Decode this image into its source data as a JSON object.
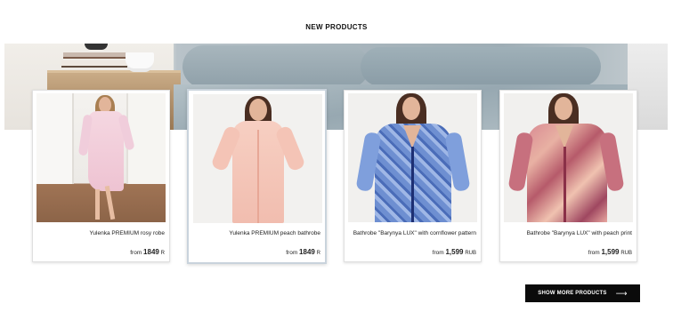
{
  "section": {
    "title": "NEW PRODUCTS"
  },
  "products": [
    {
      "name": "Yulenka PREMIUM rosy robe",
      "price_prefix": "from",
      "price": "1849",
      "currency": "R"
    },
    {
      "name": "Yulenka PREMIUM peach bathrobe",
      "price_prefix": "from",
      "price": "1849",
      "currency": "R"
    },
    {
      "name": "Bathrobe \"Barynya LUX\" with cornflower pattern",
      "price_prefix": "from",
      "price": "1,599",
      "currency": "RUB"
    },
    {
      "name": "Bathrobe \"Barynya LUX\" with peach print",
      "price_prefix": "from",
      "price": "1,599",
      "currency": "RUB"
    }
  ],
  "actions": {
    "show_more_label": "SHOW MORE PRODUCTS",
    "show_more_icon": "arrow-right-icon"
  },
  "colors": {
    "button_bg": "#0b0b0b",
    "button_text": "#ffffff",
    "banner_linen": "#9eadb5"
  }
}
